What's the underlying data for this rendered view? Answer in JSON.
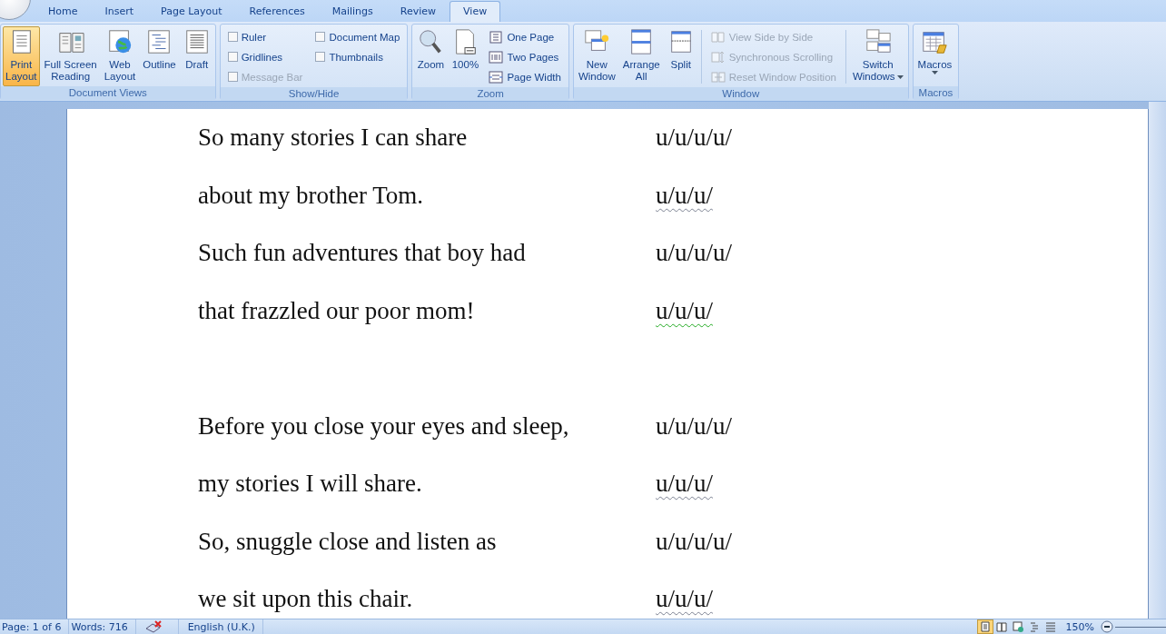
{
  "tabs": [
    {
      "label": "Home",
      "selected": false
    },
    {
      "label": "Insert",
      "selected": false
    },
    {
      "label": "Page Layout",
      "selected": false
    },
    {
      "label": "References",
      "selected": false
    },
    {
      "label": "Mailings",
      "selected": false
    },
    {
      "label": "Review",
      "selected": false
    },
    {
      "label": "View",
      "selected": true
    }
  ],
  "ribbon": {
    "groups": [
      {
        "title": "Document Views",
        "items": [
          {
            "kind": "large",
            "label": "Print Layout",
            "selected": true
          },
          {
            "kind": "large",
            "label": "Full Screen Reading",
            "selected": false
          },
          {
            "kind": "large",
            "label": "Web Layout",
            "selected": false
          },
          {
            "kind": "large",
            "label": "Outline",
            "selected": false
          },
          {
            "kind": "large",
            "label": "Draft",
            "selected": false
          }
        ]
      },
      {
        "title": "Show/Hide",
        "items": [
          {
            "kind": "checkbox",
            "label": "Ruler",
            "checked": false,
            "disabled": false
          },
          {
            "kind": "checkbox",
            "label": "Gridlines",
            "checked": false,
            "disabled": false
          },
          {
            "kind": "checkbox",
            "label": "Message Bar",
            "checked": false,
            "disabled": true
          },
          {
            "kind": "checkbox",
            "label": "Document Map",
            "checked": false,
            "disabled": false
          },
          {
            "kind": "checkbox",
            "label": "Thumbnails",
            "checked": false,
            "disabled": false
          }
        ]
      },
      {
        "title": "Zoom",
        "items": [
          {
            "kind": "large",
            "label": "Zoom"
          },
          {
            "kind": "large",
            "label": "100%"
          },
          {
            "kind": "small",
            "label": "One Page",
            "disabled": false
          },
          {
            "kind": "small",
            "label": "Two Pages",
            "disabled": false
          },
          {
            "kind": "small",
            "label": "Page Width",
            "disabled": false
          }
        ]
      },
      {
        "title": "Window",
        "items": [
          {
            "kind": "large",
            "label": "New Window"
          },
          {
            "kind": "large",
            "label": "Arrange All"
          },
          {
            "kind": "large",
            "label": "Split"
          },
          {
            "kind": "small",
            "label": "View Side by Side",
            "disabled": true
          },
          {
            "kind": "small",
            "label": "Synchronous Scrolling",
            "disabled": true
          },
          {
            "kind": "small",
            "label": "Reset Window Position",
            "disabled": true
          },
          {
            "kind": "large",
            "label": "Switch Windows",
            "menu": true
          }
        ]
      },
      {
        "title": "Macros",
        "items": [
          {
            "kind": "large",
            "label": "Macros",
            "menu": true
          }
        ]
      }
    ]
  },
  "document": {
    "stanzas": [
      {
        "lines": [
          {
            "text": "So many stories I can share",
            "meter": "u/u/u/u/",
            "spelling_error": false,
            "grammar_error": false
          },
          {
            "text": "about my brother Tom.",
            "meter": "u/u/u/",
            "spelling_error": true,
            "grammar_error": false
          },
          {
            "text": "Such fun adventures that boy had",
            "meter": "u/u/u/u/",
            "spelling_error": false,
            "grammar_error": false
          },
          {
            "text": "that frazzled our poor mom!",
            "meter": "u/u/u/",
            "spelling_error": false,
            "grammar_error": true
          }
        ]
      },
      {
        "lines": [
          {
            "text": "Before you close your eyes and sleep,",
            "meter": "u/u/u/u/",
            "spelling_error": false,
            "grammar_error": false
          },
          {
            "text": "my stories I will share.",
            "meter": "u/u/u/",
            "spelling_error": true,
            "grammar_error": false
          },
          {
            "text": "So, snuggle close and listen as",
            "meter": "u/u/u/u/",
            "spelling_error": false,
            "grammar_error": false
          },
          {
            "text": "we sit upon this chair.",
            "meter": "u/u/u/",
            "spelling_error": true,
            "grammar_error": false
          }
        ]
      }
    ]
  },
  "status_bar": {
    "page": "Page: 1 of 6",
    "words": "Words: 716",
    "language": "English (U.K.)",
    "views": [
      {
        "selected": true
      },
      {
        "selected": false
      },
      {
        "selected": false
      },
      {
        "selected": false
      },
      {
        "selected": false
      }
    ],
    "zoom": "150%"
  }
}
